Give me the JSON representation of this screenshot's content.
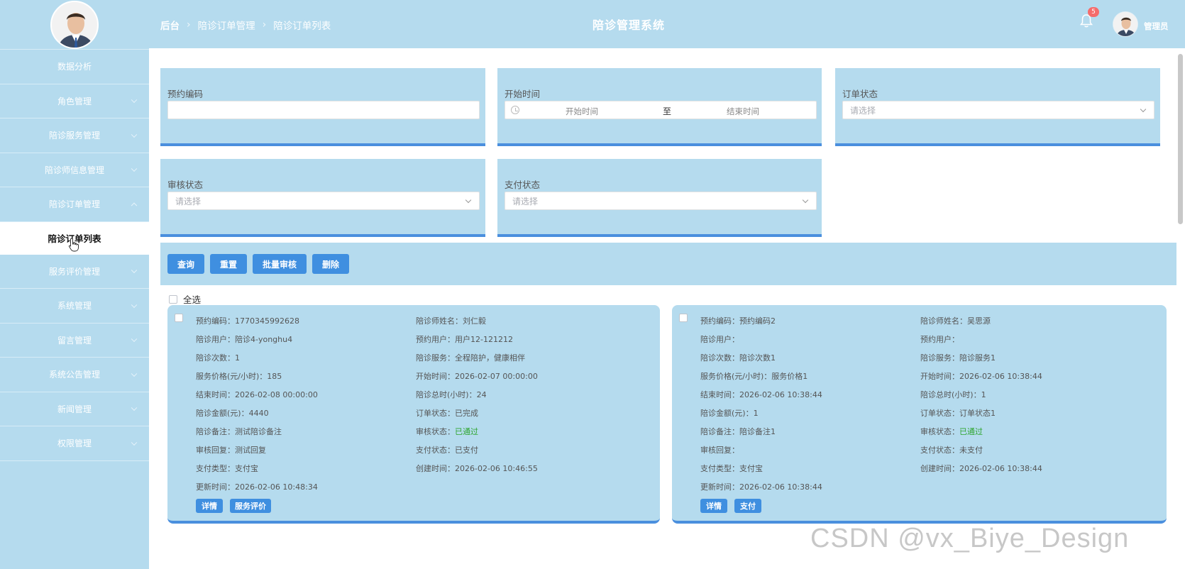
{
  "sidebar": {
    "items": [
      {
        "label": "数据分析",
        "chevron": false
      },
      {
        "label": "角色管理",
        "chevron": true
      },
      {
        "label": "陪诊服务管理",
        "chevron": true
      },
      {
        "label": "陪诊师信息管理",
        "chevron": true
      },
      {
        "label": "陪诊订单管理",
        "chevron": "up"
      }
    ],
    "active_sub": "陪诊订单列表",
    "items_after": [
      {
        "label": "服务评价管理"
      },
      {
        "label": "系统管理"
      },
      {
        "label": "留言管理"
      },
      {
        "label": "系统公告管理"
      },
      {
        "label": "新闻管理"
      },
      {
        "label": "权限管理"
      }
    ]
  },
  "header": {
    "breadcrumb": [
      "后台",
      "陪诊订单管理",
      "陪诊订单列表"
    ],
    "title": "陪诊管理系统",
    "notification_count": "5",
    "user_name": "管理员"
  },
  "filters": {
    "booking_code": {
      "label": "预约编码",
      "value": ""
    },
    "start_time": {
      "label": "开始时间",
      "start_placeholder": "开始时间",
      "to": "至",
      "end_placeholder": "结束时间"
    },
    "order_status": {
      "label": "订单状态",
      "placeholder": "请选择"
    },
    "review_status": {
      "label": "审核状态",
      "placeholder": "请选择"
    },
    "pay_status": {
      "label": "支付状态",
      "placeholder": "请选择"
    }
  },
  "actions": {
    "query": "查询",
    "reset": "重置",
    "batch_review": "批量审核",
    "delete": "删除"
  },
  "select_all": "全选",
  "cards": [
    {
      "left": [
        "预约编码：1770345992628",
        "陪诊用户：陪诊4-yonghu4",
        "陪诊次数：1",
        "服务价格(元/小时)：185",
        "结束时间：2026-02-08 00:00:00",
        "陪诊金额(元)：4440",
        "陪诊备注：测试陪诊备注",
        "审核回复：测试回复",
        "支付类型：支付宝",
        "更新时间：2026-02-06 10:48:34"
      ],
      "right": [
        "陪诊师姓名：刘仁毅",
        "预约用户：用户12-121212",
        "陪诊服务：全程陪护，健康相伴",
        "开始时间：2026-02-07 00:00:00",
        "陪诊总时(小时)：24",
        "订单状态：已完成",
        "审核状态：",
        "支付状态：已支付",
        "创建时间：2026-02-06 10:46:55"
      ],
      "review_value": "已通过",
      "buttons": [
        "详情",
        "服务评价"
      ]
    },
    {
      "left": [
        "预约编码：预约编码2",
        "陪诊用户：",
        "陪诊次数：陪诊次数1",
        "服务价格(元/小时)：服务价格1",
        "结束时间：2026-02-06 10:38:44",
        "陪诊金额(元)：1",
        "陪诊备注：陪诊备注1",
        "审核回复：",
        "支付类型：支付宝",
        "更新时间：2026-02-06 10:38:44"
      ],
      "right": [
        "陪诊师姓名：吴思源",
        "预约用户：",
        "陪诊服务：陪诊服务1",
        "开始时间：2026-02-06 10:38:44",
        "陪诊总时(小时)：1",
        "订单状态：订单状态1",
        "审核状态：",
        "支付状态：未支付",
        "创建时间：2026-02-06 10:38:44"
      ],
      "review_value": "已通过",
      "buttons": [
        "详情",
        "支付"
      ]
    }
  ],
  "watermark": "CSDN @vx_Biye_Design",
  "colors": {
    "panel": "#b5dbee",
    "accent": "#3f8fe0",
    "approved": "#2fa52f",
    "badge": "#f56c6c"
  }
}
